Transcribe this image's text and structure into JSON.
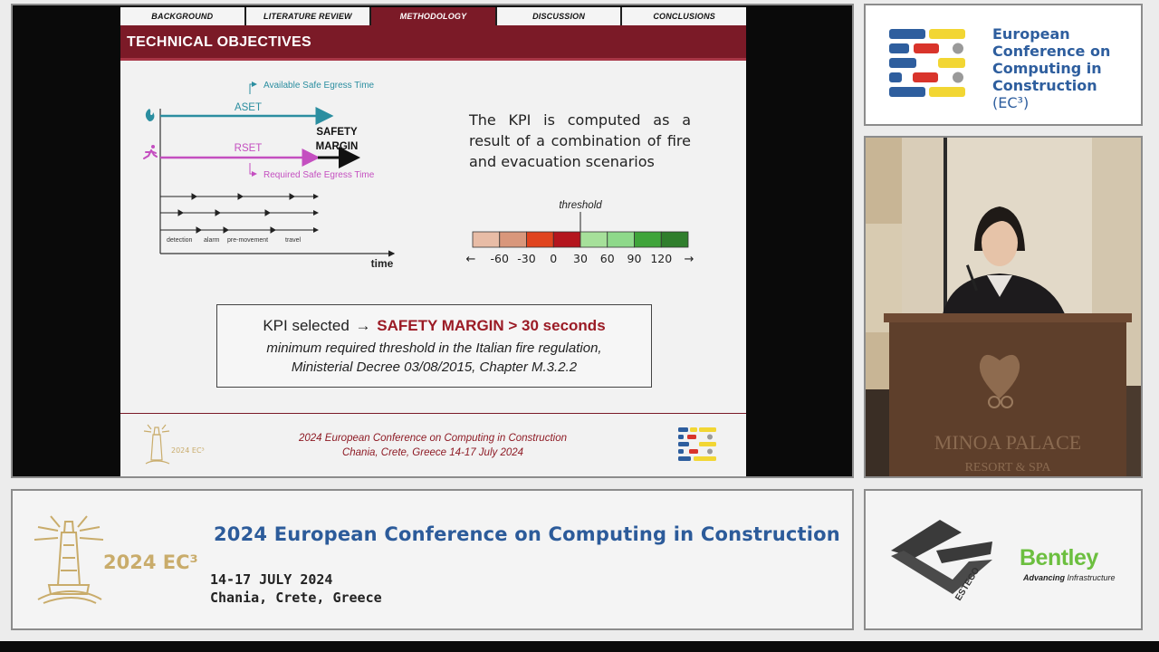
{
  "slide": {
    "nav_tabs": [
      {
        "label": "BACKGROUND",
        "active": false
      },
      {
        "label": "LITERATURE REVIEW",
        "active": false
      },
      {
        "label": "METHODOLOGY",
        "active": true
      },
      {
        "label": "DISCUSSION",
        "active": false
      },
      {
        "label": "CONCLUSIONS",
        "active": false
      }
    ],
    "title": "TECHNICAL OBJECTIVES",
    "diagram": {
      "aset_label": "ASET",
      "aset_full": "Available Safe Egress Time",
      "rset_label": "RSET",
      "rset_full": "Required Safe Egress Time",
      "safety_margin": "SAFETY",
      "safety_margin_2": "MARGIN",
      "phases": [
        "detection",
        "alarm",
        "pre-movement",
        "travel"
      ],
      "time_label": "time"
    },
    "kpi_description": "The KPI is computed as a result of a combination of fire and evacuation scenarios",
    "scale": {
      "threshold_label": "threshold",
      "tick_labels": [
        "-60",
        "-30",
        "0",
        "30",
        "60",
        "90",
        "120"
      ],
      "left_arrow": "←",
      "right_arrow": "→",
      "colors": [
        "#e8bca6",
        "#d9977b",
        "#e0441e",
        "#b4151d",
        "#a6e09a",
        "#8ed98a",
        "#3fa43a",
        "#2f7e2c"
      ]
    },
    "kpi_box": {
      "prefix": "KPI selected",
      "arrow": "→",
      "emphasis": "SAFETY MARGIN > 30 seconds",
      "note_line1": "minimum required threshold in the Italian fire regulation,",
      "note_line2": "Ministerial Decree 03/08/2015, Chapter M.3.2.2"
    },
    "footer": {
      "conference": "2024 European Conference on Computing in Construction",
      "location": "Chania, Crete, Greece 14-17 July 2024",
      "logo_text": "2024 EC³"
    }
  },
  "conference_logo": {
    "line1": "European",
    "line2": "Conference on",
    "line3": "Computing in",
    "line4": "Construction",
    "line5": "(EC³)"
  },
  "video": {
    "sign_line1": "MINOA PALACE",
    "sign_line2": "RESORT & SPA"
  },
  "banner": {
    "title": "2024 European Conference on Computing in Construction",
    "dates": "14-17 JULY 2024",
    "location": "Chania, Crete, Greece",
    "ec3": "2024 EC³"
  },
  "sponsors": {
    "esteco": "ESTECO",
    "bentley": "Bentley",
    "bentley_tag_bold": "Advancing",
    "bentley_tag_rest": " Infrastructure"
  },
  "colors": {
    "maroon": "#7b1a27",
    "aset_teal": "#2b8ea0",
    "rset_magenta": "#c44fc0",
    "blue_text": "#2c5b9a",
    "gold": "#c9ac6b",
    "bentley_green": "#6cbf3f"
  }
}
